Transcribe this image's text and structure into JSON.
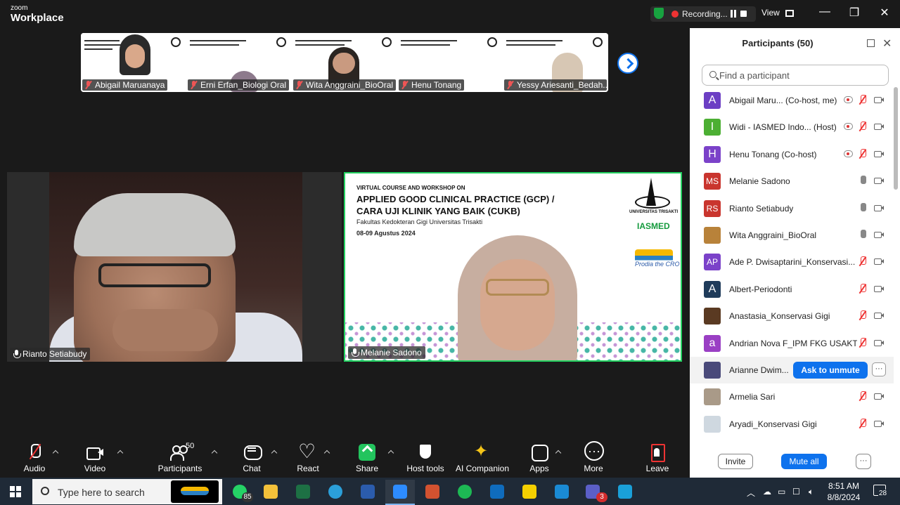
{
  "app": {
    "logo_small": "zoom",
    "logo_big": "Workplace"
  },
  "titlebar": {
    "recording_label": "Recording...",
    "view_label": "View",
    "minimize": "—",
    "maximize": "❐",
    "close": "✕"
  },
  "strip": {
    "tiles": [
      {
        "name": "Abigail Maruanaya"
      },
      {
        "name": "Erni Erfan_Biologi Oral"
      },
      {
        "name": "Wita Anggraini_BioOral"
      },
      {
        "name": "Henu Tonang"
      },
      {
        "name": "Yessy Ariesanti_Bedah..."
      }
    ]
  },
  "videos": {
    "left": {
      "name": "Rianto Setiabudy"
    },
    "right": {
      "name": "Melanie Sadono",
      "slide_small": "VIRTUAL COURSE AND WORKSHOP ON",
      "slide_title_1": "APPLIED GOOD CLINICAL PRACTICE (GCP) /",
      "slide_title_2": "CARA UJI KLINIK YANG BAIK (CUKB)",
      "slide_sub": "Fakultas Kedokteran Gigi Universitas Trisakti",
      "slide_date": "08-09 Agustus 2024",
      "univ": "UNIVERSITAS TRISAKTI",
      "iasmed": "IASMED",
      "cro": "Prodia the CRO"
    }
  },
  "toolbar": {
    "audio": "Audio",
    "video": "Video",
    "participants": "Participants",
    "participants_count": "50",
    "chat": "Chat",
    "react": "React",
    "share": "Share",
    "host_tools": "Host tools",
    "ai_companion": "AI Companion",
    "apps": "Apps",
    "more": "More",
    "leave": "Leave"
  },
  "panel": {
    "title": "Participants (50)",
    "search_placeholder": "Find a participant",
    "participants": [
      {
        "initials": "A",
        "name": "Abigail Maru... (Co-host, me)",
        "color": "#6c3fc4",
        "mic": "muted",
        "cloud": true
      },
      {
        "initials": "I",
        "name": "Widi - IASMED Indo...  (Host)",
        "color": "#4caf33",
        "mic": "muted",
        "cloud": true
      },
      {
        "initials": "H",
        "name": "Henu Tonang (Co-host)",
        "color": "#7b42c9",
        "mic": "muted",
        "cloud": true
      },
      {
        "initials": "MS",
        "name": "Melanie Sadono",
        "color": "#c9352e",
        "mic": "on",
        "cloud": false
      },
      {
        "initials": "RS",
        "name": "Rianto Setiabudy",
        "color": "#c9352e",
        "mic": "on",
        "cloud": false
      },
      {
        "initials": "",
        "name": "Wita Anggraini_BioOral",
        "color": "#b8823a",
        "mic": "on",
        "cloud": false
      },
      {
        "initials": "AP",
        "name": "Ade P. Dwisaptarini_Konservasi...",
        "color": "#7b42c9",
        "mic": "muted",
        "cloud": false
      },
      {
        "initials": "A",
        "name": "Albert-Periodonti",
        "color": "#1f3b5a",
        "mic": "muted",
        "cloud": false
      },
      {
        "initials": "",
        "name": "Anastasia_Konservasi Gigi",
        "color": "#5a3a22",
        "mic": "muted",
        "cloud": false
      },
      {
        "initials": "a",
        "name": "Andrian Nova F_IPM FKG USAKTI",
        "color": "#9a3fc4",
        "mic": "muted",
        "cloud": false
      },
      {
        "initials": "",
        "name": "Arianne Dwim...",
        "color": "#4a4a7a",
        "mic": "ask",
        "cloud": false
      },
      {
        "initials": "",
        "name": "Armelia Sari",
        "color": "#a99a88",
        "mic": "muted",
        "cloud": false
      },
      {
        "initials": "",
        "name": "Aryadi_Konservasi Gigi",
        "color": "#cfd8e0",
        "mic": "muted",
        "cloud": false
      }
    ],
    "ask_unmute": "Ask to unmute",
    "more": "···",
    "invite": "Invite",
    "mute_all": "Mute all"
  },
  "taskbar": {
    "search_placeholder": "Type here to search",
    "whatsapp_badge": "85",
    "teams_badge": "3",
    "time": "8:51 AM",
    "date": "8/8/2024",
    "notifications": "28",
    "apps": [
      {
        "name": "whatsapp",
        "color": "#25d366"
      },
      {
        "name": "file-explorer",
        "color": "#f3c13a"
      },
      {
        "name": "excel",
        "color": "#1d7044"
      },
      {
        "name": "edge",
        "color": "#2b9fd9"
      },
      {
        "name": "word",
        "color": "#2b5cad"
      },
      {
        "name": "zoom",
        "color": "#2d8cff"
      },
      {
        "name": "powerpoint",
        "color": "#d35230"
      },
      {
        "name": "spotify",
        "color": "#1db954"
      },
      {
        "name": "outlook",
        "color": "#0f6cbd"
      },
      {
        "name": "sticky-notes",
        "color": "#f5d000"
      },
      {
        "name": "outlook-new",
        "color": "#1a8ad4"
      },
      {
        "name": "teams",
        "color": "#5b5fc7"
      },
      {
        "name": "webex",
        "color": "#1aa0d8"
      }
    ]
  }
}
